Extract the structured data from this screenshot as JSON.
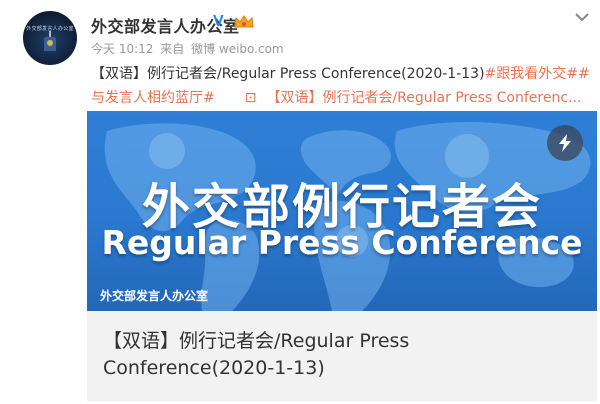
{
  "user": {
    "avatar_text": "外交部发言人办公室",
    "name": "外交部发言人办公室"
  },
  "meta": {
    "time": "今天 10:12",
    "from": "来自",
    "source": "微博 weibo.com"
  },
  "post": {
    "prefix": "【双语】例行记者会/Regular Press Conference(2020-1-13)",
    "topic": "#跟我看外交##与发言人相约蓝厅#",
    "link_icon": "⊡",
    "link_text": "【双语】例行记者会/Regular Press Conferenc..."
  },
  "card": {
    "banner_title_cn": "外交部例行记者会",
    "banner_title_en": "Regular Press Conference",
    "banner_footer": "外交部发言人办公室",
    "title": "【双语】例行记者会/Regular Press Conference(2020-1-13)"
  },
  "colors": {
    "topic": "#eb7350",
    "verify": "#1e8de2",
    "banner": "#2f7fd6"
  },
  "icons": {
    "verify": "V",
    "more": "chevron-down-icon",
    "flash": "lightning-icon",
    "crown": "crown-icon"
  }
}
